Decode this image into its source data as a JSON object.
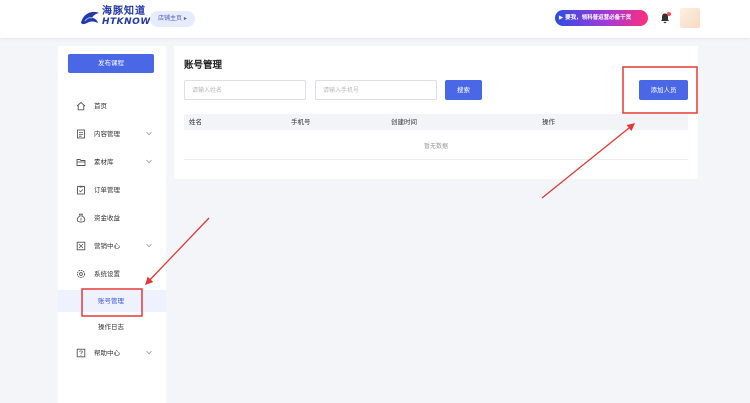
{
  "header": {
    "logo_cn": "海豚知道",
    "logo_en": "HTKNOW",
    "store_home": "店铺主页 ▸",
    "banner": "▶ 要我，领科普运营必备干货"
  },
  "sidebar": {
    "publish": "发布课程",
    "items": [
      {
        "label": "首页"
      },
      {
        "label": "内容管理"
      },
      {
        "label": "素材库"
      },
      {
        "label": "订单管理"
      },
      {
        "label": "资金收益"
      },
      {
        "label": "营销中心"
      },
      {
        "label": "系统设置"
      },
      {
        "label": "帮助中心"
      }
    ],
    "sub_items": [
      {
        "label": "账号管理"
      },
      {
        "label": "操作日志"
      }
    ]
  },
  "main": {
    "title": "账号管理",
    "name_placeholder": "请输入姓名",
    "phone_placeholder": "请输入手机号",
    "search": "搜索",
    "add": "添加人员",
    "columns": [
      "姓名",
      "手机号",
      "创建时间",
      "操作"
    ],
    "empty": "暂无数据"
  },
  "colors": {
    "primary": "#4a67e5",
    "annotation": "#e53935"
  }
}
